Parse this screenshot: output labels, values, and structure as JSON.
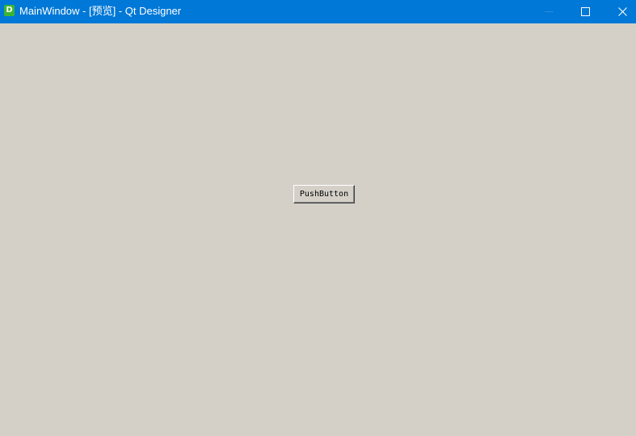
{
  "window": {
    "title": "MainWindow - [预览] - Qt Designer",
    "app_icon_letter": "D",
    "titlebar_color": "#0078d7",
    "background_color": "#d4d0c8",
    "controls": {
      "minimize_icon": "minimize-icon",
      "maximize_icon": "maximize-icon",
      "close_icon": "close-icon"
    }
  },
  "content": {
    "push_button_label": "PushButton"
  }
}
